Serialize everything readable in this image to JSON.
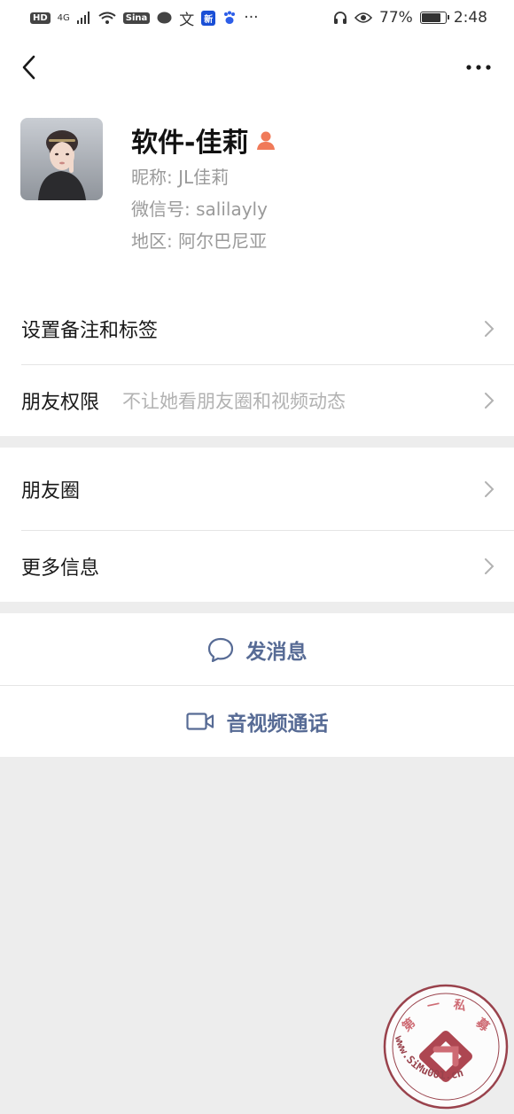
{
  "status_bar": {
    "hd": "HD",
    "network": "4G",
    "battery_percent": "77%",
    "battery_level": 0.77,
    "time": "2:48",
    "more": "···"
  },
  "nav": {
    "back_icon": "chevron-left",
    "more_icon": "ellipsis"
  },
  "profile": {
    "name": "软件-佳莉",
    "gender_icon": "female-user-icon",
    "nickname": "昵称: JL佳莉",
    "wechat_id": "微信号: salilayly",
    "region": "地区: 阿尔巴尼亚"
  },
  "settings": {
    "remark_tags": "设置备注和标签",
    "friend_permission": "朋友权限",
    "friend_permission_desc": "不让她看朋友圈和视频动态"
  },
  "info": {
    "moments": "朋友圈",
    "more_info": "更多信息"
  },
  "actions": {
    "send_message": "发消息",
    "video_call": "音视频通话"
  },
  "watermark": {
    "top_chars": [
      "第",
      "一",
      "私",
      "募"
    ],
    "url": "www.SiMu001.cn"
  },
  "colors": {
    "link": "#576b95",
    "background": "#ededed",
    "secondary_text": "#9a9a9a",
    "gender_icon": "#f07a59"
  }
}
